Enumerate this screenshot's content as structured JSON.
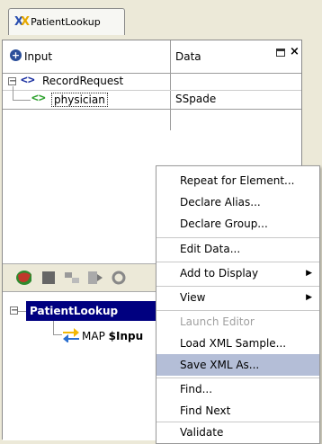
{
  "tab": {
    "label": "PatientLookup",
    "icon": "xml-icon"
  },
  "grid": {
    "columns": {
      "input": "Input",
      "data": "Data"
    },
    "rows": [
      {
        "label": "RecordRequest",
        "value": ""
      },
      {
        "label": "physician",
        "value": "SSpade"
      }
    ]
  },
  "lower_tree": {
    "root": "PatientLookup",
    "child_prefix": "MAP ",
    "child_bold": "$Inpu"
  },
  "context_menu": {
    "items": [
      {
        "label": "Repeat for Element...",
        "enabled": true
      },
      {
        "label": "Declare Alias...",
        "enabled": true
      },
      {
        "label": "Declare Group...",
        "enabled": true
      },
      {
        "label": "Edit Data...",
        "enabled": true
      },
      {
        "label": "Add to Display",
        "enabled": true,
        "submenu": true
      },
      {
        "label": "View",
        "enabled": true,
        "submenu": true
      },
      {
        "label": "Launch Editor",
        "enabled": false
      },
      {
        "label": "Load XML Sample...",
        "enabled": true
      },
      {
        "label": "Save XML As...",
        "enabled": true,
        "highlighted": true
      },
      {
        "label": "Find...",
        "enabled": true
      },
      {
        "label": "Find Next",
        "enabled": true
      },
      {
        "label": "Validate",
        "enabled": true
      }
    ]
  },
  "colors": {
    "selection_node": "#000080",
    "menu_highlight": "#b4bed7",
    "tag_blue": "#1a2fa0",
    "tag_green": "#2ca02c"
  }
}
